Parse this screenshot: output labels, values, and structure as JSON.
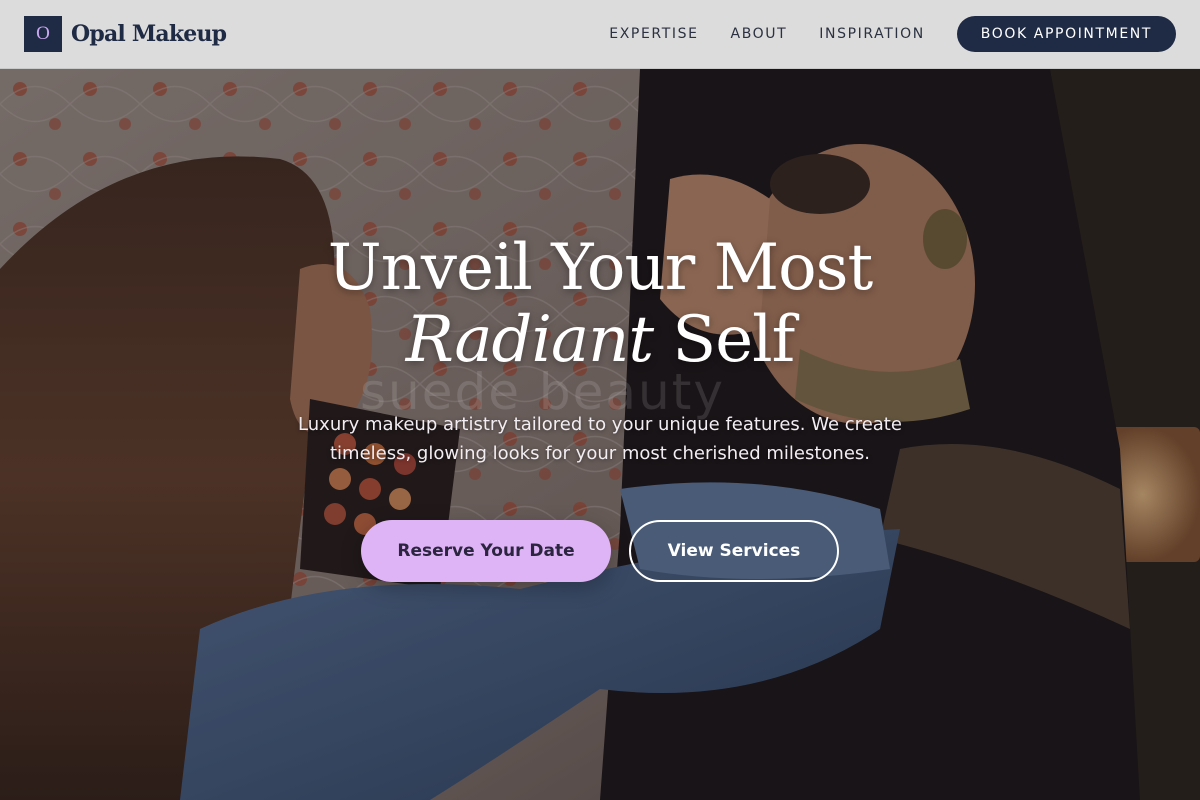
{
  "header": {
    "logo_letter": "O",
    "brand_name": "Opal Makeup",
    "nav": [
      "EXPERTISE",
      "ABOUT",
      "INSPIRATION"
    ],
    "book_label": "BOOK APPOINTMENT"
  },
  "hero": {
    "title_line1": "Unveil Your Most",
    "title_accent": "Radiant",
    "title_rest": " Self",
    "subtitle": "Luxury makeup artistry tailored to your unique features. We create timeless, glowing looks for your most cherished milestones.",
    "primary_cta": "Reserve Your Date",
    "secondary_cta": "View Services",
    "watermark": "suede beauty"
  },
  "colors": {
    "navy": "#1f2a44",
    "lavender": "#dfb4f6",
    "header_bg": "#dcdcdc"
  }
}
